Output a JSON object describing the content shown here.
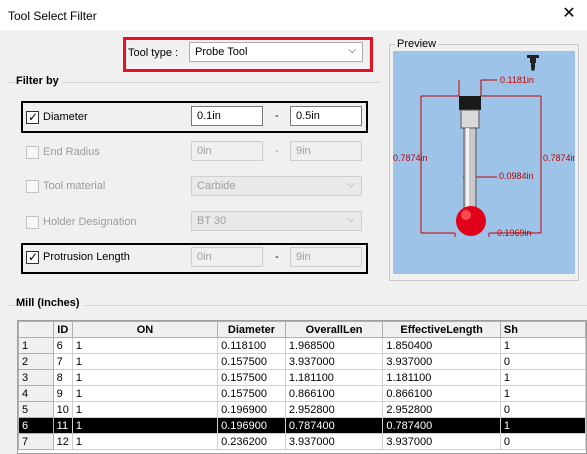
{
  "window": {
    "title": "Tool Select Filter",
    "close_glyph": "✕"
  },
  "tool_type": {
    "label": "Tool type :",
    "value": "Probe Tool",
    "chevron": "⌵"
  },
  "filter": {
    "group_label": "Filter by",
    "diameter": {
      "label": "Diameter",
      "checked": true,
      "min": "0.1in",
      "max": "0.5in",
      "dash": "-"
    },
    "end_radius": {
      "label": "End Radius",
      "checked": false,
      "min": "0in",
      "max": "9in",
      "dash": "-"
    },
    "tool_material": {
      "label": "Tool material",
      "checked": false,
      "value": "Carbide",
      "chevron": "⌵"
    },
    "holder_designation": {
      "label": "Holder Designation",
      "checked": false,
      "value": "BT 30",
      "chevron": "⌵"
    },
    "protrusion_length": {
      "label": "Protrusion Length",
      "checked": true,
      "min": "0in",
      "max": "9in",
      "dash": "-"
    }
  },
  "preview": {
    "label": "Preview",
    "dims": {
      "top_width": "0.1181in",
      "left_length": "0.7874in",
      "right_length": "0.7874in",
      "stem_dia": "0.0984in",
      "ball_dia": "0.1969in"
    }
  },
  "table": {
    "title": "Mill (Inches)",
    "columns": [
      "ID",
      "ON",
      "Diameter",
      "OverallLen",
      "EffectiveLength",
      "Sh"
    ],
    "rows": [
      {
        "row": "1",
        "id": "6",
        "on": "1",
        "diameter": "0.118100",
        "overall": "1.968500",
        "effective": "1.850400",
        "sh": "1"
      },
      {
        "row": "2",
        "id": "7",
        "on": "1",
        "diameter": "0.157500",
        "overall": "3.937000",
        "effective": "3.937000",
        "sh": "0"
      },
      {
        "row": "3",
        "id": "8",
        "on": "1",
        "diameter": "0.157500",
        "overall": "1.181100",
        "effective": "1.181100",
        "sh": "1"
      },
      {
        "row": "4",
        "id": "9",
        "on": "1",
        "diameter": "0.157500",
        "overall": "0.866100",
        "effective": "0.866100",
        "sh": "1"
      },
      {
        "row": "5",
        "id": "10",
        "on": "1",
        "diameter": "0.196900",
        "overall": "2.952800",
        "effective": "2.952800",
        "sh": "0"
      },
      {
        "row": "6",
        "id": "11",
        "on": "1",
        "diameter": "0.196900",
        "overall": "0.787400",
        "effective": "0.787400",
        "sh": "1"
      },
      {
        "row": "7",
        "id": "12",
        "on": "1",
        "diameter": "0.236200",
        "overall": "3.937000",
        "effective": "3.937000",
        "sh": "0"
      }
    ],
    "selected_row": "6"
  },
  "colors": {
    "highlight_red": "#e81123",
    "preview_bg": "#9ec3e8",
    "dim_red": "#c00000",
    "ball_red": "#e0001a"
  }
}
